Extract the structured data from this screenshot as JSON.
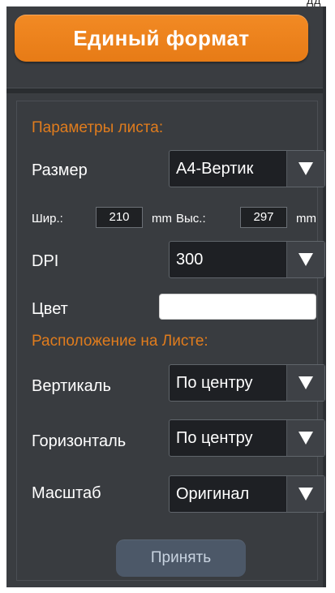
{
  "top_fragment": "дд",
  "header": {
    "title": "Единый формат"
  },
  "sheet_params": {
    "section_title": "Параметры листа:",
    "size_label": "Размер",
    "size_value": "А4-Вертик",
    "width_label": "Шир.:",
    "width_value": "210",
    "width_unit": "mm",
    "height_label": "Выс.:",
    "height_value": "297",
    "height_unit": "mm",
    "dpi_label": "DPI",
    "dpi_value": "300",
    "color_label": "Цвет",
    "color_value": "#ffffff"
  },
  "placement": {
    "section_title": "Расположение на Листе:",
    "vertical_label": "Вертикаль",
    "vertical_value": "По центру",
    "horizontal_label": "Горизонталь",
    "horizontal_value": "По центру",
    "scale_label": "Масштаб",
    "scale_value": "Оригинал"
  },
  "footer": {
    "accept_label": "Принять"
  },
  "colors": {
    "panel_bg": "#3a3d41",
    "accent_orange": "#e77b16",
    "section_title": "#e07c1d",
    "select_bg": "#1e2024",
    "accept_bg": "#4c5868"
  },
  "icons": {
    "dropdown": "triangle-down"
  }
}
